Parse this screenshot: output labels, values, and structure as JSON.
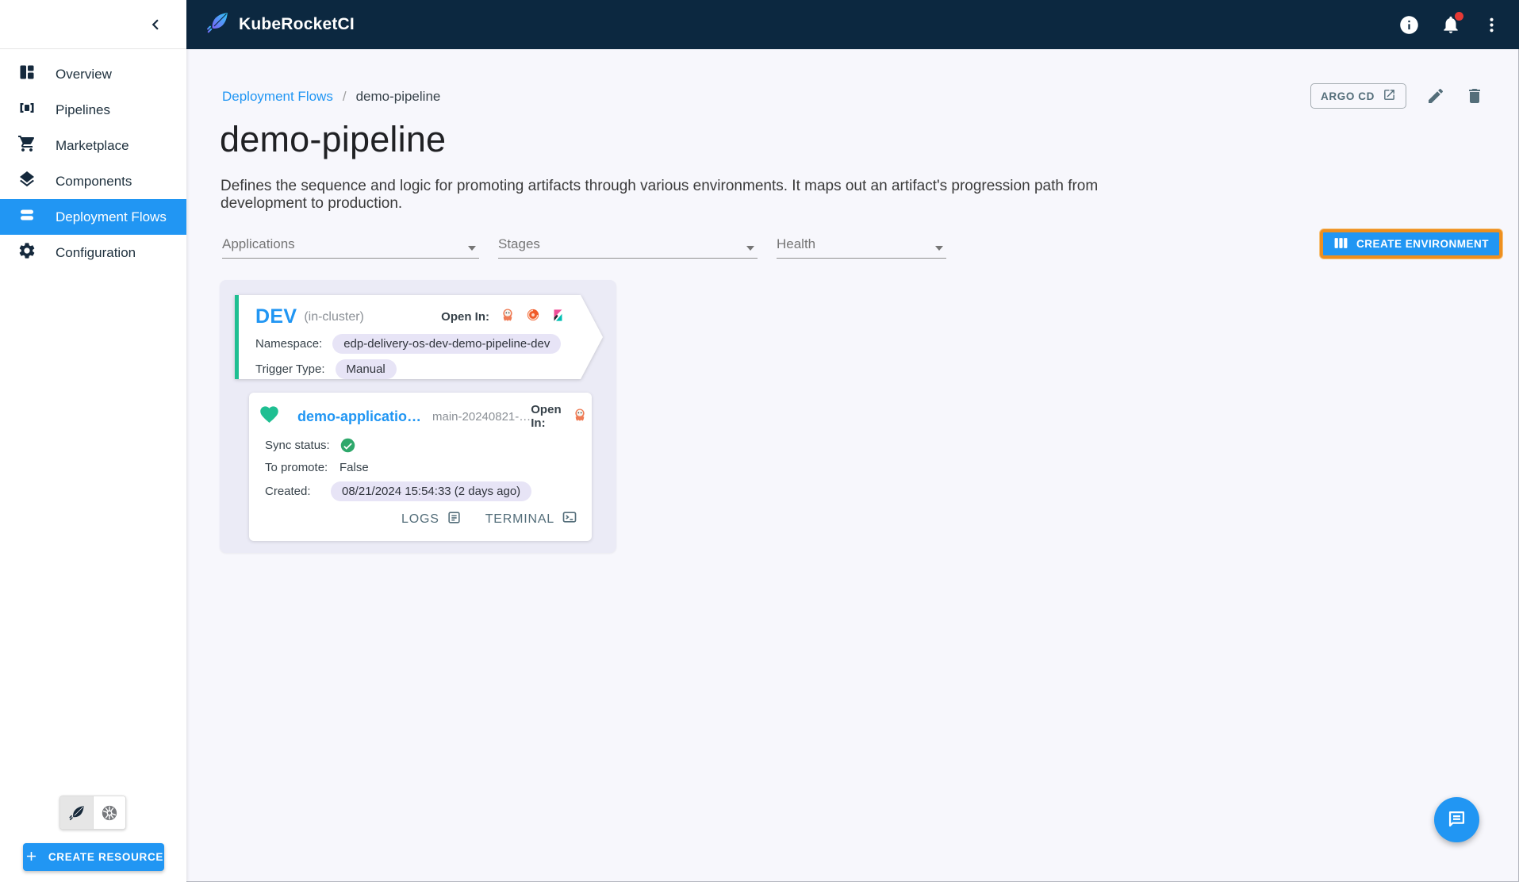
{
  "colors": {
    "accent_blue": "#2196f3",
    "header_navy": "#0c2840",
    "highlight_orange": "#ee8f1f",
    "success_green": "#1fbf92",
    "sync_check_green": "#2ea86b",
    "notification_red": "#e53935",
    "chip_lavender": "#e7e4f6",
    "group_lavender": "#ebebf6"
  },
  "appbar": {
    "title": "KubeRocketCI",
    "icons": [
      "info-icon",
      "notifications-icon",
      "kebab-menu-icon"
    ]
  },
  "sidebar": {
    "collapse_icon": "chevron-left-icon",
    "items": [
      {
        "label": "Overview",
        "icon": "dashboard-icon",
        "active": false
      },
      {
        "label": "Pipelines",
        "icon": "pipelines-icon",
        "active": false
      },
      {
        "label": "Marketplace",
        "icon": "cart-icon",
        "active": false
      },
      {
        "label": "Components",
        "icon": "layers-icon",
        "active": false
      },
      {
        "label": "Deployment Flows",
        "icon": "stacked-bars-icon",
        "active": true
      },
      {
        "label": "Configuration",
        "icon": "gear-icon",
        "active": false
      }
    ],
    "footer": {
      "toggle": [
        {
          "icon": "kuberocketci-logo-icon",
          "selected": true
        },
        {
          "icon": "kubernetes-icon",
          "selected": false
        }
      ],
      "create_resource_label": "CREATE RESOURCE"
    }
  },
  "breadcrumb": {
    "parent": "Deployment Flows",
    "separator": "/",
    "current": "demo-pipeline"
  },
  "page_header": {
    "title": "demo-pipeline",
    "description": "Defines the sequence and logic for promoting artifacts through various environments. It maps out an artifact's progression path from development to production.",
    "argo_cd_button": "ARGO CD"
  },
  "filters": {
    "applications_label": "Applications",
    "stages_label": "Stages",
    "health_label": "Health"
  },
  "create_environment_label": "CREATE ENVIRONMENT",
  "stage": {
    "name": "DEV",
    "cluster": "(in-cluster)",
    "open_in_label": "Open In:",
    "open_in": [
      "argocd-icon",
      "grafana-icon",
      "kibana-icon"
    ],
    "namespace_label": "Namespace:",
    "namespace_value": "edp-delivery-os-dev-demo-pipeline-dev",
    "trigger_type_label": "Trigger Type:",
    "trigger_type_value": "Manual"
  },
  "application": {
    "health_icon": "heart-icon",
    "name": "demo-applicatio…",
    "version": "main-20240821-…",
    "open_in_label": "Open In:",
    "open_in": [
      "argocd-icon"
    ],
    "sync_status_label": "Sync status:",
    "sync_status_icon": "check-circle-icon",
    "to_promote_label": "To promote:",
    "to_promote_value": "False",
    "created_label": "Created:",
    "created_value": "08/21/2024 15:54:33 (2 days ago)",
    "logs_label": "LOGS",
    "terminal_label": "TERMINAL"
  }
}
